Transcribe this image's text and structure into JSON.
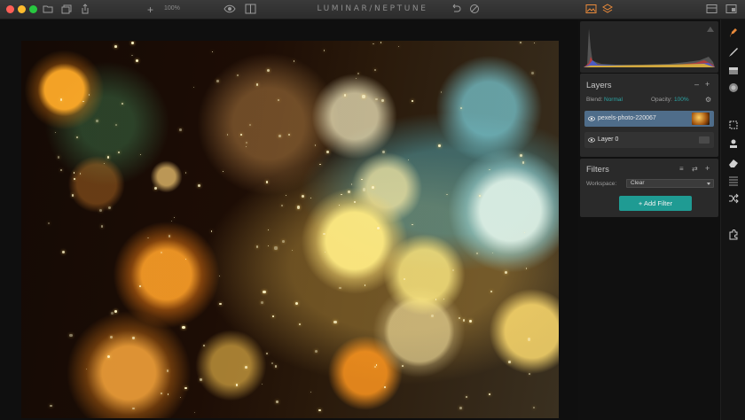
{
  "window": {
    "title": "LUMINAR/NEPTUNE",
    "zoom_label": "100%",
    "traffic_colors": [
      "#ff5f57",
      "#febc2e",
      "#28c840"
    ]
  },
  "toolbar": {
    "left_icons": [
      "folder-icon",
      "batch-icon",
      "share-icon",
      "plus-icon"
    ],
    "center_icons": [
      "eye-icon",
      "compare-icon"
    ],
    "undo_icons": [
      "undo-icon",
      "reset-icon"
    ],
    "right_icons": [
      "image-icon",
      "layers-icon",
      "panels-icon",
      "fullscreen-icon"
    ]
  },
  "layers": {
    "title": "Layers",
    "blend_label": "Blend:",
    "blend_value": "Normal",
    "opacity_label": "Opacity:",
    "opacity_value": "100%",
    "items": [
      {
        "name": "pexels-photo-220067",
        "selected": true
      },
      {
        "name": "Layer 0",
        "selected": false
      }
    ]
  },
  "filters": {
    "title": "Filters",
    "workspace_label": "Workspace:",
    "workspace_value": "Clear",
    "add_filter_label": "Add Filter"
  },
  "tools": [
    "presets-icon",
    "brush-icon",
    "gradient-icon",
    "radial-icon",
    "crop-icon",
    "clone-stamp-icon",
    "eraser-icon",
    "transform-icon",
    "random-icon",
    "puzzle-icon"
  ],
  "colors": {
    "accent": "#2ba6a6",
    "button": "#1f9b93",
    "selected_layer": "#4f6d8a",
    "tool_highlight": "#e8893a"
  }
}
